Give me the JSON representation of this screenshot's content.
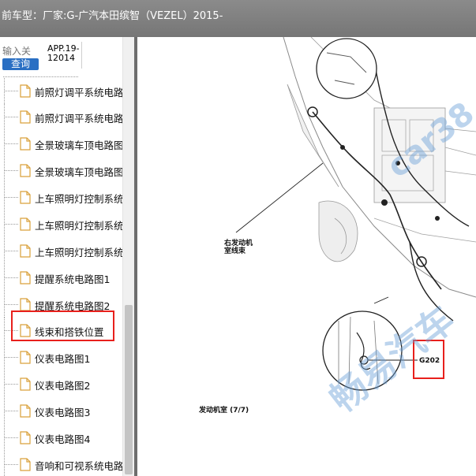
{
  "titlebar": {
    "text": "前车型：厂家:G-广汽本田缤智（VEZEL）2015-"
  },
  "search": {
    "placeholder": "输入关",
    "button_label": "查询"
  },
  "app_tag": {
    "line1": "APP.19-",
    "line2": "12014"
  },
  "tree": {
    "items": [
      {
        "label": "前照灯调平系统电路"
      },
      {
        "label": "前照灯调平系统电路"
      },
      {
        "label": "全景玻璃车顶电路图"
      },
      {
        "label": "全景玻璃车顶电路图"
      },
      {
        "label": "上车照明灯控制系统"
      },
      {
        "label": "上车照明灯控制系统"
      },
      {
        "label": "上车照明灯控制系统"
      },
      {
        "label": "提醒系统电路图1"
      },
      {
        "label": "提醒系统电路图2"
      },
      {
        "label": "线束和搭铁位置"
      },
      {
        "label": "仪表电路图1"
      },
      {
        "label": "仪表电路图2"
      },
      {
        "label": "仪表电路图3"
      },
      {
        "label": "仪表电路图4"
      },
      {
        "label": "音响和可视系统电路"
      }
    ],
    "selected_index": 9
  },
  "diagram": {
    "label_harness_1": "右发动机",
    "label_harness_2": "室线束",
    "ground_point": "G202",
    "caption": "发动机室 (7/7)",
    "watermark_1": "畅易汽车",
    "watermark_2": "car38"
  },
  "colors": {
    "accent": "#2a6fc3",
    "highlight": "#e8201c",
    "titlebar": "#808080"
  }
}
